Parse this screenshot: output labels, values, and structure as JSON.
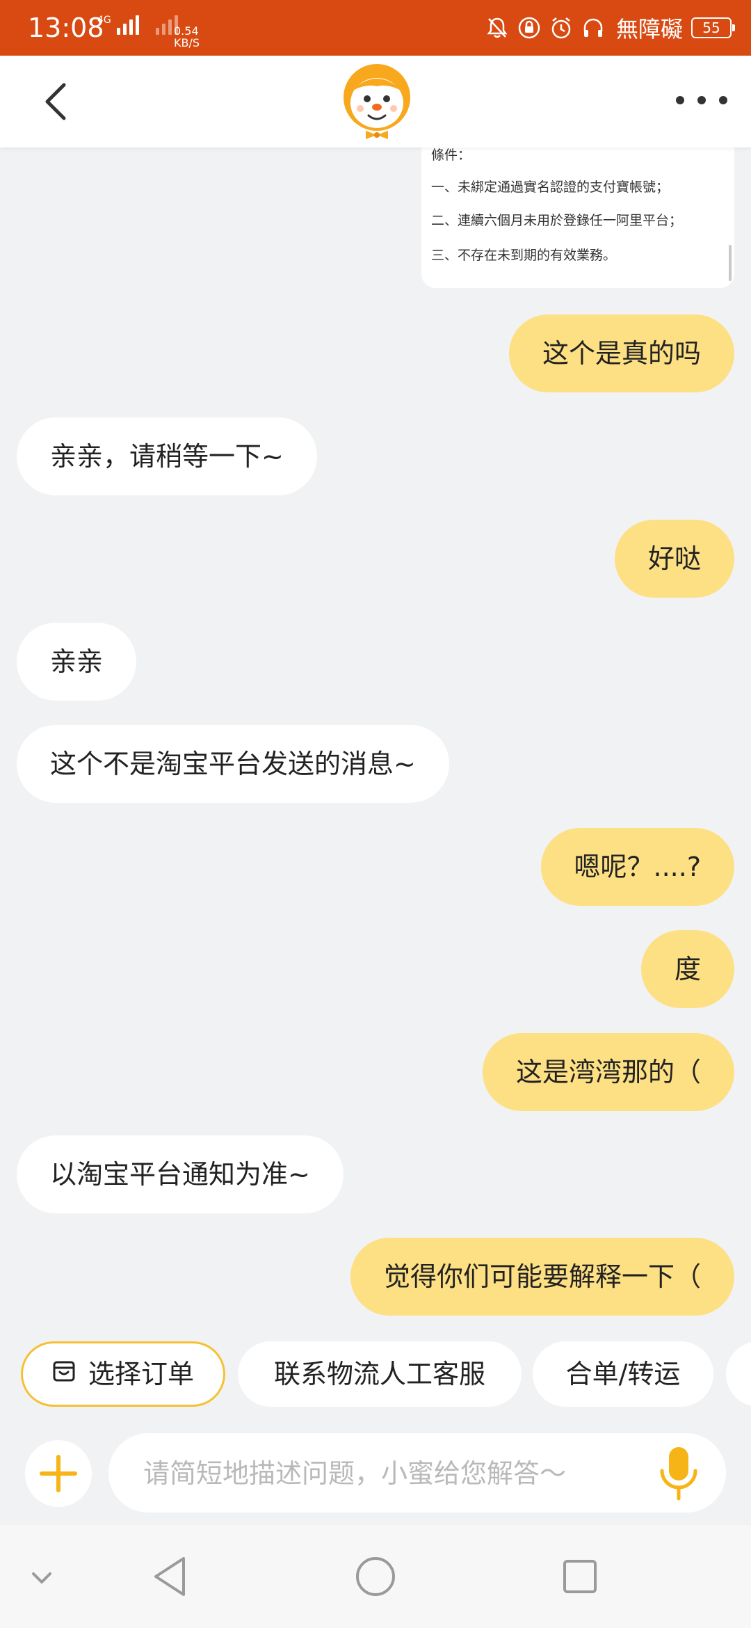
{
  "status_bar": {
    "time": "13:08",
    "network_type": "4G",
    "speed_value": "0.54",
    "speed_unit": "KB/S",
    "carrier": "無障礙",
    "battery": "55"
  },
  "header": {
    "back_icon": "chevron-left-icon",
    "avatar_icon": "mascot-avatar-icon",
    "more_icon": "more-dots-icon"
  },
  "screenshot_card": {
    "lines": [
      "條件：",
      "一、未綁定通過實名認證的支付寶帳號；",
      "二、連續六個月未用於登錄任一阿里平台；",
      "三、不存在未到期的有效業務。"
    ]
  },
  "messages": [
    {
      "from": "user",
      "text": "这个是真的吗"
    },
    {
      "from": "agent",
      "text": "亲亲，请稍等一下~"
    },
    {
      "from": "user",
      "text": "好哒"
    },
    {
      "from": "agent",
      "text": "亲亲"
    },
    {
      "from": "agent",
      "text": "这个不是淘宝平台发送的消息~"
    },
    {
      "from": "user",
      "text": "嗯呢？....?"
    },
    {
      "from": "user",
      "text": "度"
    },
    {
      "from": "user",
      "text": "这是湾湾那的（"
    },
    {
      "from": "agent",
      "text": "以淘宝平台通知为准~"
    },
    {
      "from": "user",
      "text": "觉得你们可能要解释一下（"
    }
  ],
  "quick_actions": [
    {
      "label": "选择订单",
      "icon": "order-box-icon"
    },
    {
      "label": "联系物流人工客服"
    },
    {
      "label": "合单/转运"
    }
  ],
  "input_bar": {
    "placeholder": "请简短地描述问题，小蜜给您解答～",
    "plus_icon": "plus-icon",
    "mic_icon": "microphone-icon"
  },
  "colors": {
    "status_bar": "#d84a12",
    "user_bubble": "#fde084",
    "agent_bubble": "#ffffff",
    "accent": "#f7c034",
    "background": "#f1f2f4"
  }
}
